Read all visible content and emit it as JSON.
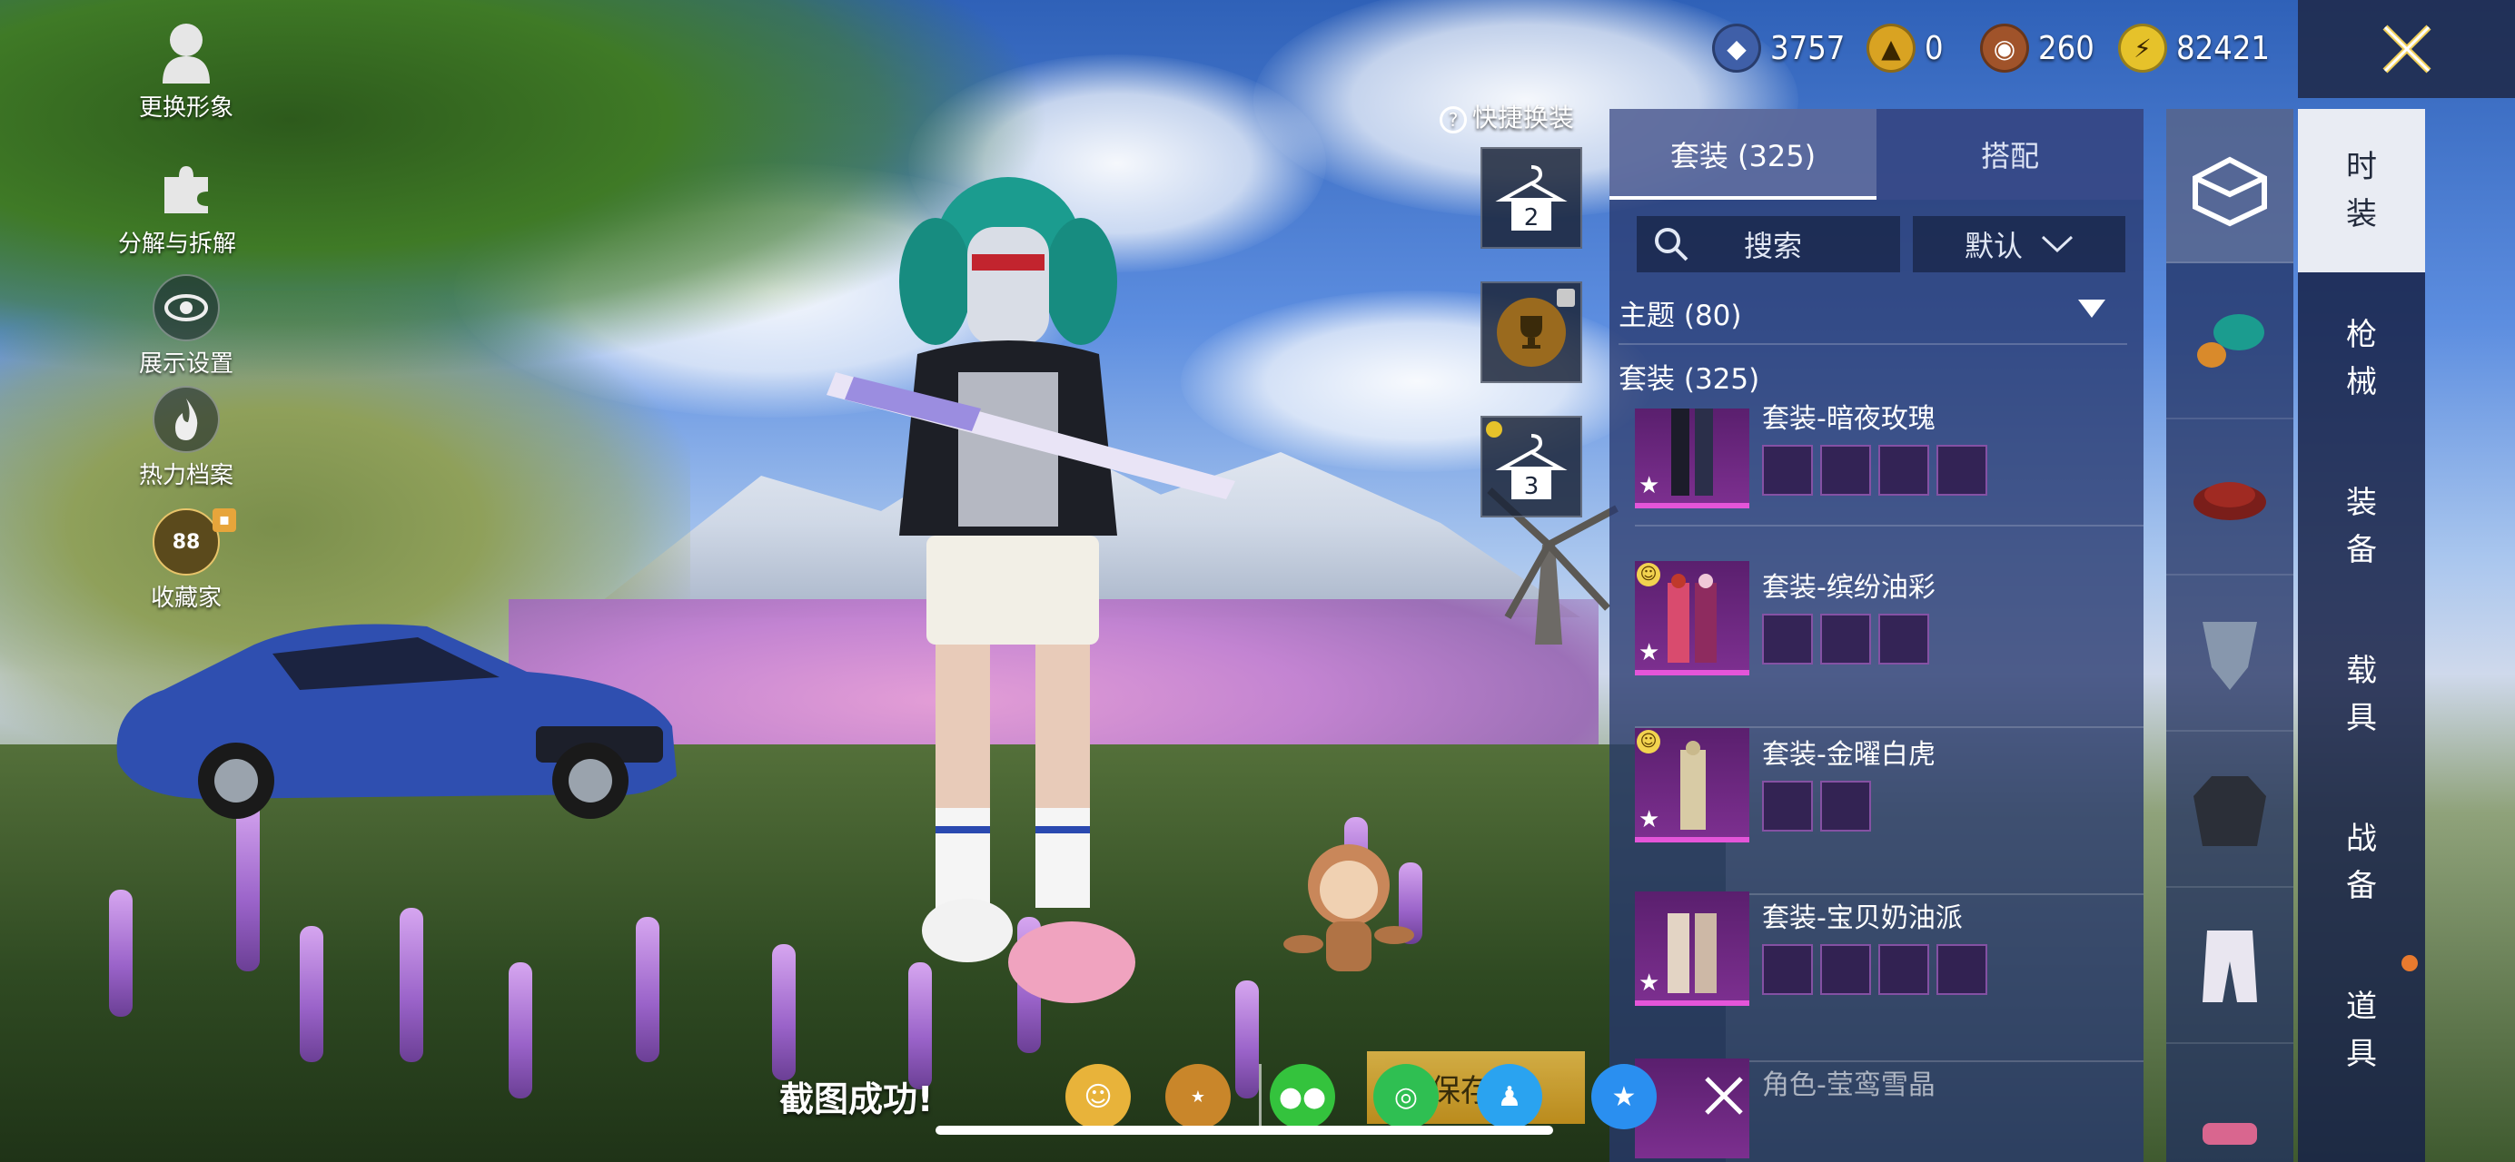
{
  "left_menu": [
    {
      "label": "更换形象",
      "icon": "person-silhouette-icon"
    },
    {
      "label": "分解与拆解",
      "icon": "puzzle-icon"
    },
    {
      "label": "展示设置",
      "icon": "eye-icon"
    },
    {
      "label": "热力档案",
      "icon": "flame-icon"
    },
    {
      "label": "收藏家",
      "icon": "collector-badge-icon",
      "badge_level": "88"
    }
  ],
  "currencies": [
    {
      "icon": "diamond-coin-icon",
      "value": "3757",
      "color": "#3f5fa8"
    },
    {
      "icon": "gold-emblem-icon",
      "value": "0",
      "color": "#d9a322"
    },
    {
      "icon": "bronze-coin-icon",
      "value": "260",
      "color": "#a0532a"
    },
    {
      "icon": "lightning-coin-icon",
      "value": "82421",
      "color": "#e6c22a"
    }
  ],
  "quick_change": {
    "label": "快捷换装",
    "slots": [
      {
        "type": "hanger",
        "number": "2"
      },
      {
        "type": "locked-trophy",
        "number": ""
      },
      {
        "type": "hanger",
        "number": "3"
      }
    ]
  },
  "panel": {
    "tabs": [
      {
        "label": "套装 (325)",
        "active": true
      },
      {
        "label": "搭配",
        "active": false
      }
    ],
    "search_label": "搜索",
    "sort_label": "默认",
    "category_theme": "主题 (80)",
    "category_suit": "套装 (325)",
    "items": [
      {
        "name": "套装-暗夜玫瑰",
        "parts": 4,
        "rarity_color": "#e455d9"
      },
      {
        "name": "套装-缤纷油彩",
        "parts": 3,
        "rarity_color": "#e455d9"
      },
      {
        "name": "套装-金曜白虎",
        "parts": 2,
        "rarity_color": "#e455d9"
      },
      {
        "name": "套装-宝贝奶油派",
        "parts": 4,
        "rarity_color": "#e455d9"
      },
      {
        "name": "角色-莹鸾雪晶",
        "parts": 0,
        "rarity_color": "#e455d9"
      }
    ]
  },
  "category_icons": [
    {
      "name": "wardrobe-icon",
      "active": true
    },
    {
      "name": "hair-icon",
      "active": false
    },
    {
      "name": "hat-icon",
      "active": false
    },
    {
      "name": "mask-icon",
      "active": false
    },
    {
      "name": "jacket-icon",
      "active": false
    },
    {
      "name": "pants-icon",
      "active": false
    },
    {
      "name": "shoes-icon",
      "active": false
    }
  ],
  "right_nav": [
    {
      "label": "时装",
      "active": true
    },
    {
      "label": "枪械",
      "active": false
    },
    {
      "label": "装备",
      "active": false
    },
    {
      "label": "载具",
      "active": false
    },
    {
      "label": "战备",
      "active": false
    },
    {
      "label": "道具",
      "active": false
    }
  ],
  "share_bar": {
    "toast": "截图成功!",
    "save_label": "保存到",
    "targets": [
      {
        "name": "peace-elite-friends-icon",
        "color": "#e8b33a"
      },
      {
        "name": "game-logo-icon",
        "color": "#c9862a"
      },
      {
        "name": "wechat-icon",
        "color": "#34c33d"
      },
      {
        "name": "moments-icon",
        "color": "#2fbf52"
      },
      {
        "name": "qq-icon",
        "color": "#2aa3f0"
      },
      {
        "name": "qzone-icon",
        "color": "#2a8ff0"
      }
    ]
  }
}
